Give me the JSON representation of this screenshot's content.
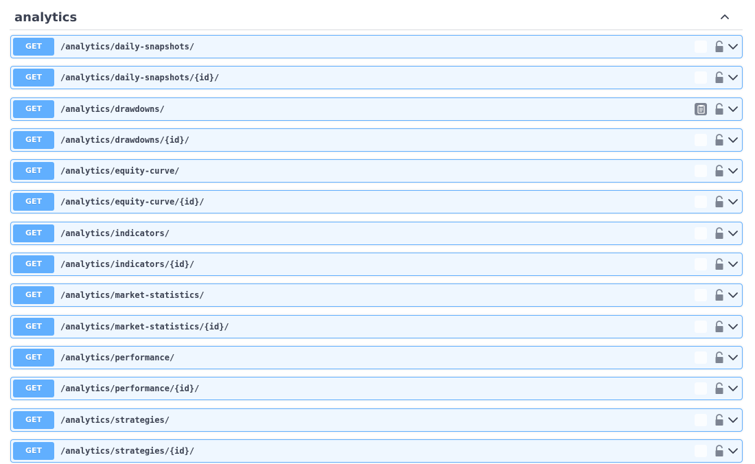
{
  "section": {
    "title": "analytics",
    "collapse_icon": "chevron-up-icon"
  },
  "colors": {
    "get_method": "#61affe",
    "row_background": "#ebf3fb",
    "text": "#3b4151"
  },
  "operations": [
    {
      "method": "GET",
      "path": "/analytics/daily-snapshots/",
      "copy_visible": false
    },
    {
      "method": "GET",
      "path": "/analytics/daily-snapshots/{id}/",
      "copy_visible": false
    },
    {
      "method": "GET",
      "path": "/analytics/drawdowns/",
      "copy_visible": true
    },
    {
      "method": "GET",
      "path": "/analytics/drawdowns/{id}/",
      "copy_visible": false
    },
    {
      "method": "GET",
      "path": "/analytics/equity-curve/",
      "copy_visible": false
    },
    {
      "method": "GET",
      "path": "/analytics/equity-curve/{id}/",
      "copy_visible": false
    },
    {
      "method": "GET",
      "path": "/analytics/indicators/",
      "copy_visible": false
    },
    {
      "method": "GET",
      "path": "/analytics/indicators/{id}/",
      "copy_visible": false
    },
    {
      "method": "GET",
      "path": "/analytics/market-statistics/",
      "copy_visible": false
    },
    {
      "method": "GET",
      "path": "/analytics/market-statistics/{id}/",
      "copy_visible": false
    },
    {
      "method": "GET",
      "path": "/analytics/performance/",
      "copy_visible": false
    },
    {
      "method": "GET",
      "path": "/analytics/performance/{id}/",
      "copy_visible": false
    },
    {
      "method": "GET",
      "path": "/analytics/strategies/",
      "copy_visible": false
    },
    {
      "method": "GET",
      "path": "/analytics/strategies/{id}/",
      "copy_visible": false
    }
  ],
  "icons": {
    "copy": "clipboard-icon",
    "lock": "lock-icon",
    "expand": "chevron-down-icon"
  }
}
